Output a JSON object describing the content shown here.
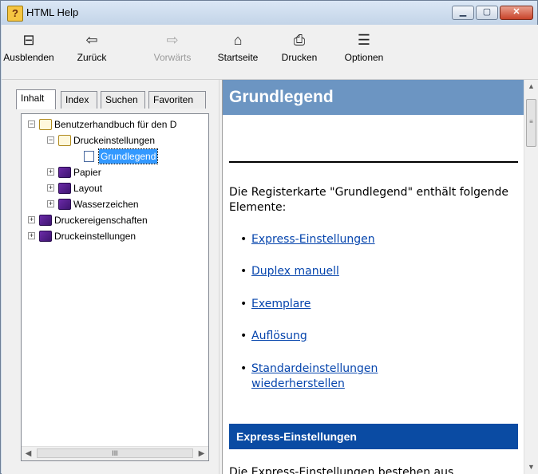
{
  "window": {
    "title": "HTML Help",
    "controls": {
      "minimize": "▁",
      "maximize": "▢",
      "close": "✕"
    }
  },
  "toolbar": {
    "buttons": [
      {
        "label": "Ausblenden",
        "icon": "hide-pane-icon",
        "glyph": "⊟",
        "enabled": true
      },
      {
        "label": "Zurück",
        "icon": "back-arrow-icon",
        "glyph": "⇦",
        "enabled": true
      },
      {
        "label": "Vorwärts",
        "icon": "forward-arrow-icon",
        "glyph": "⇨",
        "enabled": false
      },
      {
        "label": "Startseite",
        "icon": "home-icon",
        "glyph": "⌂",
        "enabled": true
      },
      {
        "label": "Drucken",
        "icon": "printer-icon",
        "glyph": "⎙",
        "enabled": true
      },
      {
        "label": "Optionen",
        "icon": "options-icon",
        "glyph": "☰",
        "enabled": true
      }
    ]
  },
  "nav": {
    "tabs": [
      "Inhalt",
      "Index",
      "Suchen",
      "Favoriten"
    ],
    "active_tab": "Inhalt",
    "tree": [
      {
        "label": "Benutzerhandbuch für den D",
        "level": 0,
        "expander": "⊟",
        "book": "open"
      },
      {
        "label": "Druckeinstellungen",
        "level": 1,
        "expander": "⊟",
        "book": "open"
      },
      {
        "label": "Grundlegend",
        "level": 2,
        "expander": "",
        "book": "page",
        "selected": true
      },
      {
        "label": "Papier",
        "level": 1,
        "expander": "⊞",
        "book": "closed"
      },
      {
        "label": "Layout",
        "level": 1,
        "expander": "⊞",
        "book": "closed"
      },
      {
        "label": "Wasserzeichen",
        "level": 1,
        "expander": "⊞",
        "book": "closed"
      },
      {
        "label": "Druckereigenschaften",
        "level": 0,
        "expander": "⊞",
        "book": "closed"
      },
      {
        "label": "Druckeinstellungen",
        "level": 0,
        "expander": "⊞",
        "book": "closed"
      }
    ],
    "hscroll": {
      "left": "◀",
      "thumb": "III",
      "right": "▶"
    }
  },
  "content": {
    "title": "Grundlegend",
    "intro": "Die Registerkarte \"Grundlegend\" enthält folgende Elemente:",
    "links": [
      "Express-Einstellungen",
      "Duplex manuell",
      "Exemplare",
      "Auflösung",
      "Standardeinstellungen wiederherstellen"
    ],
    "section_heading": "Express-Einstellungen",
    "truncated_text": "Die Express-Einstellungen bestehen aus"
  },
  "colors": {
    "title_bar_bg": "#6c95c2",
    "section_bar_bg": "#0a4ba3",
    "link": "#0645ad",
    "selection": "#3399ff"
  }
}
